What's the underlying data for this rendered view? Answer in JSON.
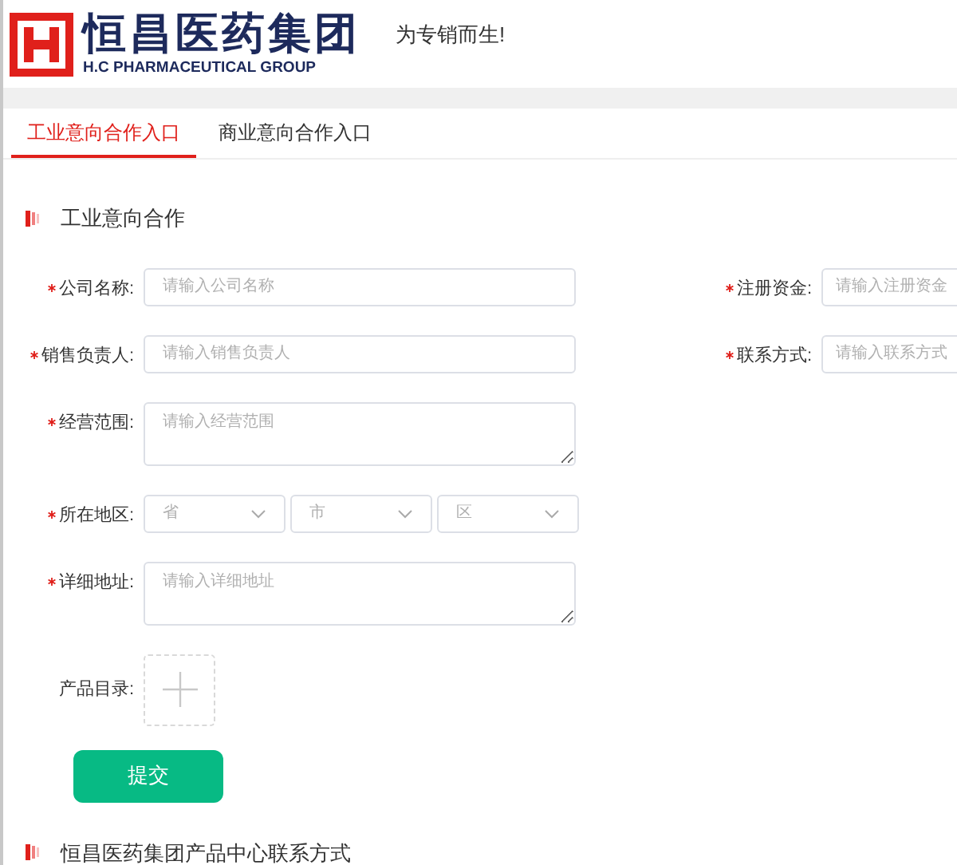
{
  "header": {
    "brand": "恒昌医药集团",
    "brand_en": "H.C PHARMACEUTICAL GROUP",
    "slogan": "为专销而生!"
  },
  "tabs": [
    {
      "label": "工业意向合作入口",
      "selected": true
    },
    {
      "label": "商业意向合作入口",
      "selected": false
    }
  ],
  "form": {
    "title": "工业意向合作",
    "rows": [
      {
        "fields": [
          {
            "kind": "input",
            "label": "公司名称:",
            "required": true,
            "placeholder": "请输入公司名称"
          },
          {
            "kind": "input",
            "label": "注册资金:",
            "required": true,
            "placeholder": "请输入注册资金"
          }
        ]
      },
      {
        "fields": [
          {
            "kind": "input",
            "label": "销售负责人:",
            "required": true,
            "placeholder": "请输入销售负责人"
          },
          {
            "kind": "input",
            "label": "联系方式:",
            "required": true,
            "placeholder": "请输入联系方式"
          }
        ]
      },
      {
        "fields": [
          {
            "kind": "textarea",
            "label": "经营范围:",
            "required": true,
            "placeholder": "请输入经营范围"
          }
        ]
      },
      {
        "fields": [
          {
            "kind": "selects",
            "label": "所在地区:",
            "required": true,
            "options": [
              "省",
              "市",
              "区"
            ]
          }
        ]
      },
      {
        "fields": [
          {
            "kind": "textarea",
            "label": "详细地址:",
            "required": true,
            "placeholder": "请输入详细地址"
          }
        ]
      },
      {
        "fields": [
          {
            "kind": "upload",
            "label": "产品目录:",
            "required": false
          }
        ]
      }
    ],
    "submit": "提交"
  },
  "section2": {
    "title": "恒昌医药集团产品中心联系方式"
  }
}
